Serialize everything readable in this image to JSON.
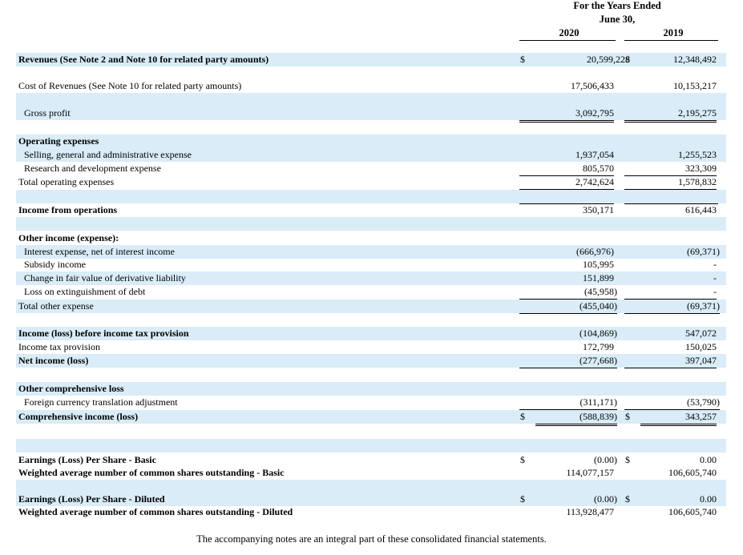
{
  "header": {
    "period_line1": "For the Years Ended",
    "period_line2": "June 30,",
    "year_2020": "2020",
    "year_2019": "2019"
  },
  "rows": {
    "revenues": {
      "label": "Revenues (See Note 2 and Note 10 for related party amounts)",
      "d2020": "$",
      "v2020": "20,599,228",
      "d2019": "$",
      "v2019": "12,348,492"
    },
    "cost_of_revenues": {
      "label": "Cost of Revenues (See Note 10 for related party amounts)",
      "v2020": "17,506,433",
      "v2019": "10,153,217"
    },
    "gross_profit": {
      "label": "Gross profit",
      "v2020": "3,092,795",
      "v2019": "2,195,275"
    },
    "operating_expenses": {
      "label": "Operating expenses"
    },
    "sga": {
      "label": "Selling, general and administrative expense",
      "v2020": "1,937,054",
      "v2019": "1,255,523"
    },
    "rnd": {
      "label": "Research and development expense",
      "v2020": "805,570",
      "v2019": "323,309"
    },
    "total_opex": {
      "label": "Total operating expenses",
      "v2020": "2,742,624",
      "v2019": "1,578,832"
    },
    "income_ops": {
      "label": "Income from operations",
      "v2020": "350,171",
      "v2019": "616,443"
    },
    "other_income": {
      "label": "Other income (expense):"
    },
    "interest": {
      "label": "Interest expense, net of interest income",
      "v2020": "(666,976)",
      "v2019": "(69,371)"
    },
    "subsidy": {
      "label": "Subsidy income",
      "v2020": "105,995",
      "v2019": "-"
    },
    "fair_value": {
      "label": "Change in fair value of derivative liability",
      "v2020": "151,899",
      "v2019": "-"
    },
    "loss_ext": {
      "label": "Loss on extinguishment of debt",
      "v2020": "(45,958)",
      "v2019": "-"
    },
    "total_other": {
      "label": "Total other expense",
      "v2020": "(455,040)",
      "v2019": "(69,371)"
    },
    "income_before_tax": {
      "label": "Income (loss) before income tax provision",
      "v2020": "(104,869)",
      "v2019": "547,072"
    },
    "tax_provision": {
      "label": "Income tax provision",
      "v2020": "172,799",
      "v2019": "150,025"
    },
    "net_income": {
      "label": "Net income (loss)",
      "v2020": "(277,668)",
      "v2019": "397,047"
    },
    "ocl": {
      "label": "Other comprehensive loss"
    },
    "fx": {
      "label": "Foreign currency translation adjustment",
      "v2020": "(311,171)",
      "v2019": "(53,790)"
    },
    "comprehensive": {
      "label": "Comprehensive income (loss)",
      "d2020": "$",
      "v2020": "(588,839)",
      "d2019": "$",
      "v2019": "343,257"
    },
    "eps_basic": {
      "label": "Earnings (Loss) Per Share - Basic",
      "d2020": "$",
      "v2020": "(0.00)",
      "d2019": "$",
      "v2019": "0.00"
    },
    "shares_basic": {
      "label": "Weighted average number of common shares outstanding - Basic",
      "v2020": "114,077,157",
      "v2019": "106,605,740"
    },
    "eps_diluted": {
      "label": "Earnings (Loss) Per Share - Diluted",
      "d2020": "$",
      "v2020": "(0.00)",
      "d2019": "$",
      "v2019": "0.00"
    },
    "shares_diluted": {
      "label": "Weighted average number of common shares outstanding - Diluted",
      "v2020": "113,928,477",
      "v2019": "106,605,740"
    }
  },
  "footer": "The accompanying notes are an integral part of these consolidated financial statements.",
  "colors": {
    "row_shade": "#d9ecf7"
  }
}
